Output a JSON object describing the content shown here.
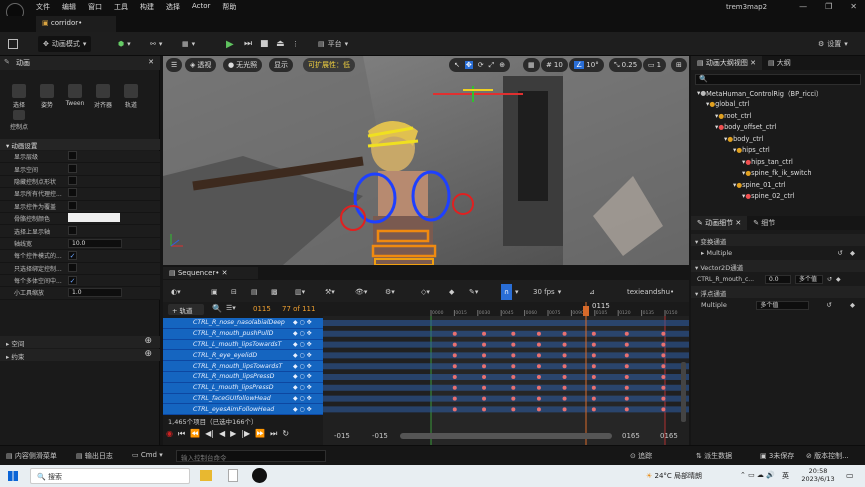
{
  "window": {
    "title": "trem3map2",
    "doc_tab": "corridor•",
    "menu": [
      "文件",
      "编辑",
      "窗口",
      "工具",
      "构建",
      "选择",
      "Actor",
      "帮助"
    ]
  },
  "toolbar": {
    "mode": "动画模式",
    "platform": "平台",
    "settings": "设置"
  },
  "left_panel": {
    "title": "动画",
    "modes": [
      "选择",
      "姿势",
      "Tween",
      "对齐器",
      "轨道",
      "控制点"
    ],
    "section": "动画设置",
    "props": [
      {
        "label": "显示层级",
        "type": "check",
        "checked": false
      },
      {
        "label": "显示空间",
        "type": "check",
        "checked": false
      },
      {
        "label": "隐藏控制点形状",
        "type": "check",
        "checked": false
      },
      {
        "label": "显示所有代理控...",
        "type": "check",
        "checked": false
      },
      {
        "label": "显示控件为覆盖",
        "type": "check",
        "checked": false
      },
      {
        "label": "骨骼控制颜色",
        "type": "color",
        "value": ""
      },
      {
        "label": "选择上显示轴",
        "type": "check",
        "checked": false
      },
      {
        "label": "轴线宽",
        "type": "text",
        "value": "10.0"
      },
      {
        "label": "每个控件模式的...",
        "type": "check",
        "checked": true
      },
      {
        "label": "只选择绑定控制...",
        "type": "check",
        "checked": false
      },
      {
        "label": "每个多体空间中...",
        "type": "check",
        "checked": true
      },
      {
        "label": "小工具缩放",
        "type": "text",
        "value": "1.0"
      }
    ],
    "sections2": [
      "空间",
      "约束"
    ]
  },
  "viewport": {
    "perspective": "透视",
    "lighting": "无光照",
    "show": "显示",
    "scalability": "可扩展性：低",
    "grid": "10",
    "angle": "10°",
    "scale": "0.25",
    "cams": "1"
  },
  "sequencer": {
    "tab": "Sequencer•",
    "add_track": "+ 轨道",
    "current_frame": "0115",
    "count": "77 of 111",
    "fps": "30 fps",
    "sequence_name": "texieandshu•",
    "playhead": "0115",
    "tracks": [
      "CTRL_R_nose_nasolabialDeep",
      "CTRL_R_mouth_pushPullD",
      "CTRL_L_mouth_lipsTowardsT",
      "CTRL_R_eye_eyelidD",
      "CTRL_R_mouth_lipsTowardsT",
      "CTRL_R_mouth_lipsPressD",
      "CTRL_L_mouth_lipsPressD",
      "CTRL_faceGUIfollowHead",
      "CTRL_eyesAimFollowHead"
    ],
    "items_count": "1,465个项目（已选中166个）",
    "range_start": "-015",
    "range_start2": "-015",
    "range_end": "0165",
    "range_end2": "0165",
    "ruler": [
      "0000",
      "0015",
      "0030",
      "0045",
      "0060",
      "0075",
      "0090",
      "0105",
      "0120",
      "0135",
      "0150"
    ],
    "key_columns": [
      0.36,
      0.44,
      0.52,
      0.59,
      0.66,
      0.74,
      0.83,
      0.93
    ]
  },
  "outliner": {
    "tabs": [
      "动画大纲视图",
      "大纲"
    ],
    "search_placeholder": "",
    "rows": [
      {
        "label": "MetaHuman_ControlRig（BP_ricci）",
        "indent": 0
      },
      {
        "label": "global_ctrl",
        "indent": 1
      },
      {
        "label": "root_ctrl",
        "indent": 2
      },
      {
        "label": "body_offset_ctrl",
        "indent": 2
      },
      {
        "label": "body_ctrl",
        "indent": 3
      },
      {
        "label": "hips_ctrl",
        "indent": 4
      },
      {
        "label": "hips_tan_ctrl",
        "indent": 5
      },
      {
        "label": "spine_fk_ik_switch",
        "indent": 5
      },
      {
        "label": "spine_01_ctrl",
        "indent": 4
      },
      {
        "label": "spine_02_ctrl",
        "indent": 5
      }
    ]
  },
  "details": {
    "tabs": [
      "动画细节",
      "细节"
    ],
    "sec1": "变换通道",
    "multiple": "Multiple",
    "sec2": "Vector2D通道",
    "v2_label": "CTRL_R_mouth_c...",
    "v2_val": "0.0",
    "v2_multi": "多个值",
    "sec3": "浮点通道",
    "float_label": "Multiple",
    "float_val": "多个值"
  },
  "statusbar": {
    "drawer": "内容侧滑菜单",
    "log": "输出日志",
    "cmd": "Cmd",
    "console_placeholder": "输入控制台命令",
    "trace": "追踪",
    "derived": "派生数据",
    "unsaved": "3未保存",
    "source": "版本控制..."
  },
  "taskbar": {
    "search": "搜索",
    "weather": "24°C 局部晴朗",
    "time": "20:58",
    "date": "2023/6/13",
    "lang": "英"
  }
}
